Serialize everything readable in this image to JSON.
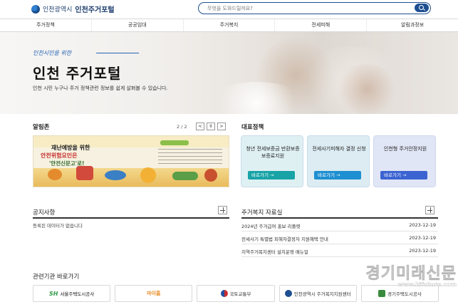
{
  "header": {
    "city_label": "인천광역시",
    "portal_label": "인천주거포털",
    "search_placeholder": "무엇을 도와드릴까요?"
  },
  "nav": {
    "items": [
      "주거정책",
      "공공임대",
      "주거복지",
      "전세피해",
      "알림과정보"
    ]
  },
  "hero": {
    "subtitle": "인천시민을 위한",
    "title": "인천 주거포털",
    "description": "인천 시민 누구나 주거 정책관련 정보를 쉽게 살펴볼 수 있습니다."
  },
  "notices": {
    "title": "알림존",
    "pager": "2 / 2",
    "prev_label": "<",
    "pause_label": "II",
    "next_label": ">",
    "banner": {
      "line1": "재난예방을 위한",
      "line2": "안전위험요인은",
      "line3": "'안전신문고'로!"
    }
  },
  "policies": {
    "title": "대표정책",
    "cards": [
      {
        "text": "청년 전세보증금 반환보증 보증료지원",
        "button": "바로가기 →"
      },
      {
        "text": "전세사기피해자 결정 신청",
        "button": "바로가기 →"
      },
      {
        "text": "인천형 주거안정지원",
        "button": "바로가기 →"
      }
    ]
  },
  "board_notice": {
    "title": "공지사항",
    "empty_text": "등록된 데이터가 없습니다"
  },
  "board_welfare": {
    "title": "주거복지 자료실",
    "rows": [
      {
        "title": "2024년 주거급여 홍보 리플렛",
        "date": "2023-12-19"
      },
      {
        "title": "전세사기 특별법 피해자결정자 지원혜택 안내",
        "date": "2023-12-19"
      },
      {
        "title": "지역주거복지센터 설치운영 매뉴얼",
        "date": "2023-12-19"
      }
    ]
  },
  "related": {
    "title": "관련기관 바로가기",
    "orgs": [
      {
        "mark": "SH",
        "label": "서울주택도시공사"
      },
      {
        "label": "마이홈"
      },
      {
        "label": "국토교통부"
      },
      {
        "label": "인천광역시 주거복지지원센터"
      },
      {
        "label": "경기주택도시공사"
      }
    ]
  },
  "watermark": {
    "main": "경기미래신문",
    "url": "www.kifuture.com"
  }
}
